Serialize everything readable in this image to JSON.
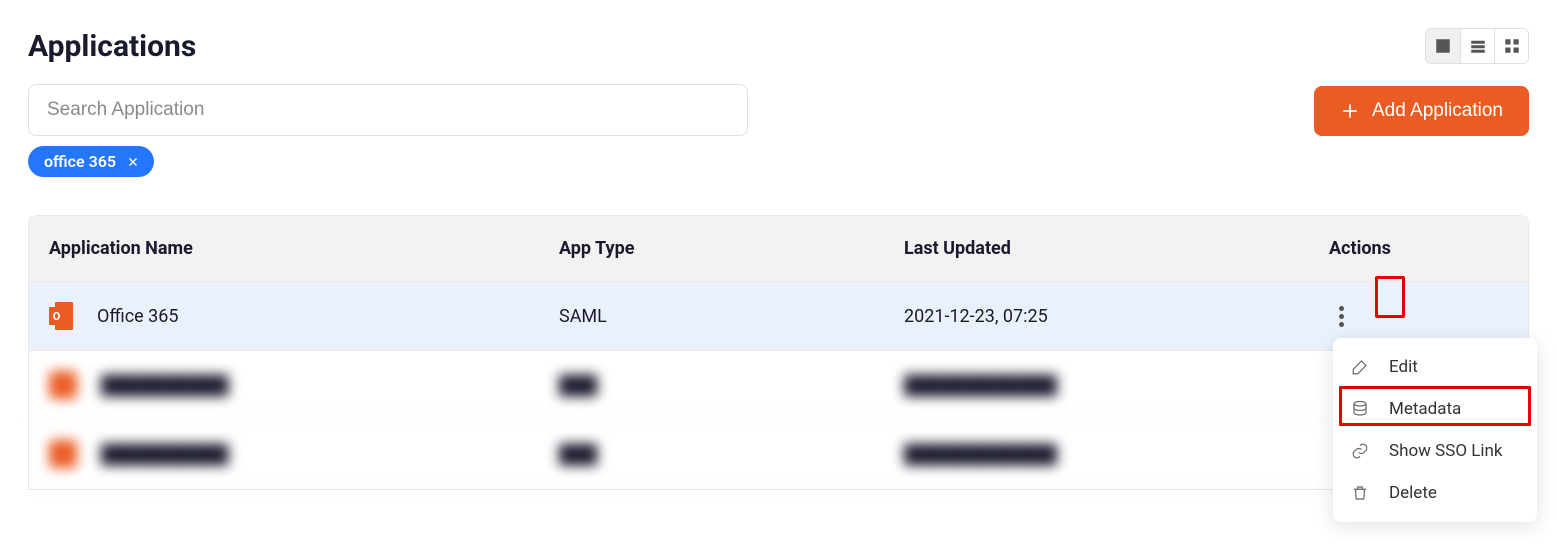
{
  "header": {
    "title": "Applications"
  },
  "search": {
    "placeholder": "Search Application"
  },
  "filter": {
    "chip_label": "office 365"
  },
  "buttons": {
    "add_application": "Add Application"
  },
  "table": {
    "columns": {
      "name": "Application Name",
      "type": "App Type",
      "updated": "Last Updated",
      "actions": "Actions"
    },
    "rows": [
      {
        "name": "Office 365",
        "type": "SAML",
        "updated": "2021-12-23, 07:25"
      },
      {
        "name": "██████████",
        "type": "███",
        "updated": "████████████"
      },
      {
        "name": "██████████",
        "type": "███",
        "updated": "████████████"
      }
    ]
  },
  "dropdown": {
    "edit": "Edit",
    "metadata": "Metadata",
    "show_sso": "Show SSO Link",
    "delete": "Delete"
  }
}
